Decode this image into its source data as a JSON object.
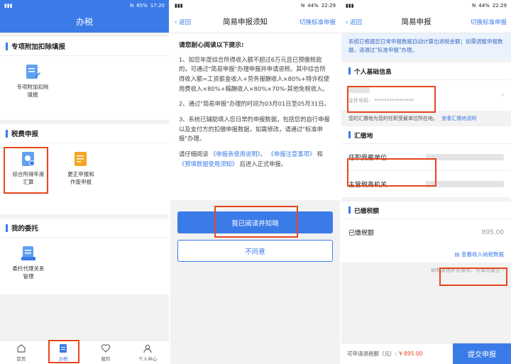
{
  "status_bar": {
    "p1_battery": "85%",
    "p1_time": "17:20",
    "p2_battery": "44%",
    "p2_time": "22:29",
    "p3_battery": "44%",
    "p3_time": "22:29"
  },
  "panel1": {
    "title": "办税",
    "section1_title": "专项附加扣除填报",
    "section1_items": [
      "专项附加扣除\n填报"
    ],
    "section2_title": "税费申报",
    "section2_items": [
      "综合所得年度\n汇算",
      "更正申报和\n作废申报"
    ],
    "section3_title": "我的委托",
    "section3_items": [
      "委托代理关系\n管理"
    ],
    "tabs": [
      "首页",
      "办税",
      "我的",
      "个人中心"
    ]
  },
  "panel2": {
    "back": "返回",
    "title": "简易申报须知",
    "switch": "切换标准申报",
    "heading": "请您耐心阅读以下提示:",
    "p1": "1、如您年度综合所得收入额不超过6万元且已预缴税款的，可通过\"简易申报\"办理申报并申请退税。其中综合所得收入额=工资薪金收入+劳务报酬收入×80%+特许权使用费收入×80%+稿酬收入×80%×70%-其他免税收入。",
    "p2": "2、通过\"简易申报\"办理的时间为03月01日至05月31日。",
    "p3": "3、系统已辅助填入您日常的申报数据，包括您的自行申报以及支付方的扣缴申报数据，如需修改，请通过\"标准申报\"办理。",
    "p4_pre": "请仔细阅读",
    "link1": "《申报表使用说明》",
    "p4_mid1": "、",
    "link2": "《申报注意事项》",
    "p4_mid2": "和",
    "link3": "《预填数据使用须知》",
    "p4_post": "后进入正式申报。",
    "agree": "我已阅读并知晓",
    "disagree": "不同意"
  },
  "panel3": {
    "back": "返回",
    "title": "简易申报",
    "switch": "切换标准申报",
    "info": "系统已根据您日常申报数据自动计算出退税金额；如需调整申报数据，请通过\"标准申报\"办理。",
    "basic_title": "个人基础信息",
    "id_label": "证件号码:",
    "id_value": "****************",
    "region_note": "您的汇缴地为您的任职受雇单位所在地。",
    "region_link": "查看汇缴地说明",
    "region_title": "汇缴地",
    "employer_label": "任职受雇单位",
    "tax_office_label": "主管税务机关",
    "paid_title": "已缴税额",
    "paid_label": "已缴税额",
    "paid_value": "895.00",
    "view_income": "查看收入纳税数据",
    "other_note": "如有其他补充事项，可填写备注",
    "refund_label": "可申请退税额（元）:",
    "refund_value": "¥ 895.00",
    "submit": "提交申报"
  }
}
